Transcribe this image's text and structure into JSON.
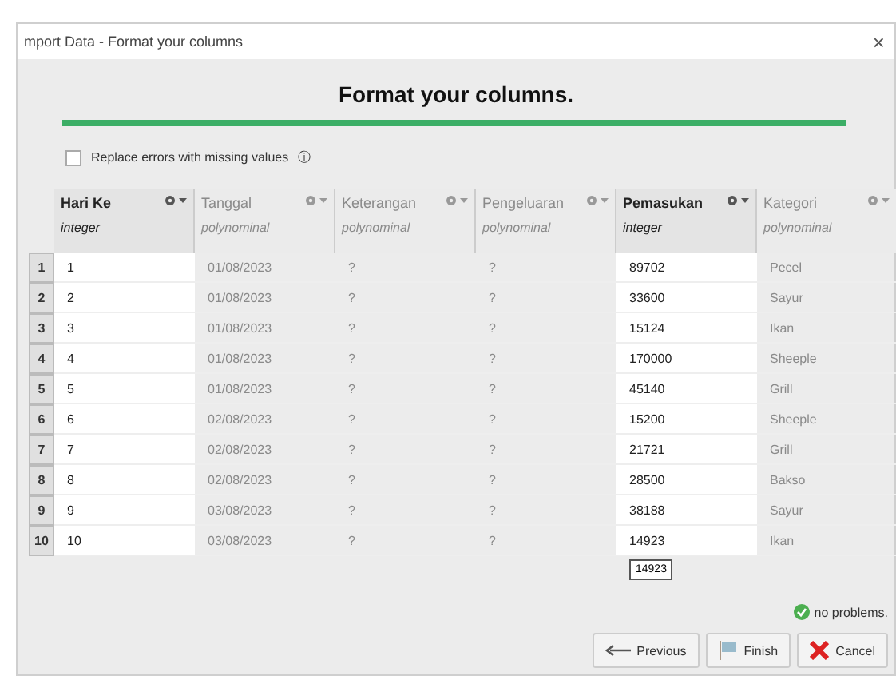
{
  "window": {
    "title": "mport Data - Format your columns",
    "close": "×"
  },
  "heading": "Format your columns.",
  "progress": {
    "level": 1
  },
  "replace_errors": {
    "label": "Replace errors with missing values",
    "checked": false,
    "info": "ⓘ"
  },
  "table": {
    "columns": [
      {
        "name": "Hari Ke",
        "type": "integer",
        "enabled": true
      },
      {
        "name": "Tanggal",
        "type": "polynominal",
        "enabled": false
      },
      {
        "name": "Keterangan",
        "type": "polynominal",
        "enabled": false
      },
      {
        "name": "Pengeluaran",
        "type": "polynominal",
        "enabled": false
      },
      {
        "name": "Pemasukan",
        "type": "integer",
        "enabled": true
      },
      {
        "name": "Kategori",
        "type": "polynominal",
        "enabled": false
      }
    ],
    "rows": [
      {
        "number": "1",
        "cells": [
          "1",
          "01/08/2023",
          "?",
          "?",
          "89702",
          "Pecel"
        ]
      },
      {
        "number": "2",
        "cells": [
          "2",
          "01/08/2023",
          "?",
          "?",
          "33600",
          "Sayur"
        ]
      },
      {
        "number": "3",
        "cells": [
          "3",
          "01/08/2023",
          "?",
          "?",
          "15124",
          "Ikan"
        ]
      },
      {
        "number": "4",
        "cells": [
          "4",
          "01/08/2023",
          "?",
          "?",
          "170000",
          "Sheeple"
        ]
      },
      {
        "number": "5",
        "cells": [
          "5",
          "01/08/2023",
          "?",
          "?",
          "45140",
          "Grill"
        ]
      },
      {
        "number": "6",
        "cells": [
          "6",
          "02/08/2023",
          "?",
          "?",
          "15200",
          "Sheeple"
        ]
      },
      {
        "number": "7",
        "cells": [
          "7",
          "02/08/2023",
          "?",
          "?",
          "21721",
          "Grill"
        ]
      },
      {
        "number": "8",
        "cells": [
          "8",
          "02/08/2023",
          "?",
          "?",
          "28500",
          "Bakso"
        ]
      },
      {
        "number": "9",
        "cells": [
          "9",
          "03/08/2023",
          "?",
          "?",
          "38188",
          "Sayur"
        ]
      },
      {
        "number": "10",
        "cells": [
          "10",
          "03/08/2023",
          "?",
          "?",
          "14923",
          "Ikan"
        ]
      }
    ],
    "tooltip": "14923"
  },
  "status": "no problems.",
  "buttons": [
    {
      "kind": "previous",
      "label": "Previous"
    },
    {
      "kind": "finish",
      "label": "Finish"
    },
    {
      "kind": "cancel",
      "label": "Cancel"
    }
  ]
}
